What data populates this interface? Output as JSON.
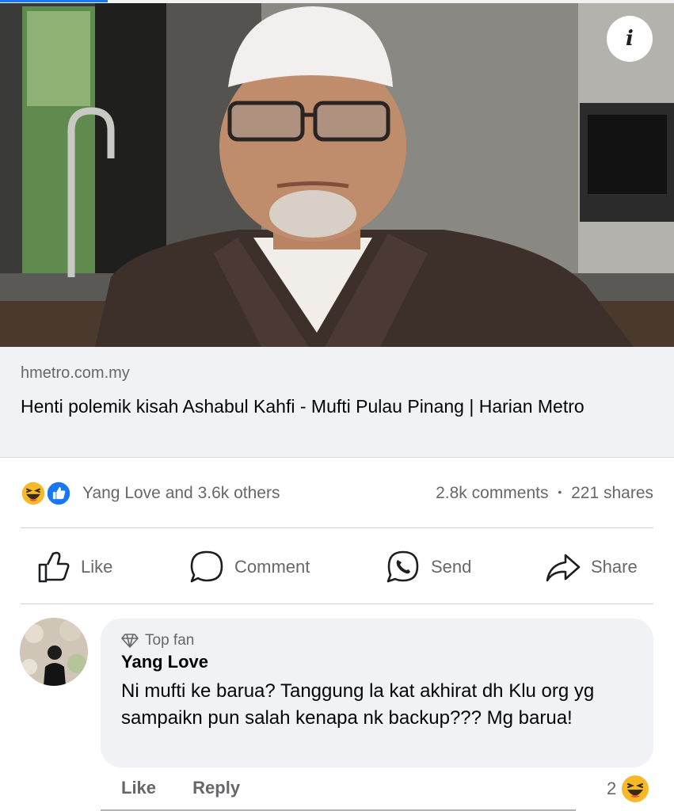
{
  "post": {
    "image": {
      "alt": ""
    },
    "link": {
      "domain": "hmetro.com.my",
      "title": "Henti polemik kisah Ashabul Kahfi - Mufti Pulau Pinang | Harian Metro"
    },
    "reactions": {
      "types": [
        "haha",
        "like"
      ],
      "names_text": "Yang Love and 3.6k others",
      "comments_text": "2.8k comments",
      "separator": "•",
      "shares_text": "221 shares"
    },
    "actions": [
      {
        "label": "Like",
        "icon": "thumbs-up-icon"
      },
      {
        "label": "Comment",
        "icon": "speech-bubble-icon"
      },
      {
        "label": "Send",
        "icon": "whatsapp-icon"
      },
      {
        "label": "Share",
        "icon": "share-arrow-icon"
      }
    ]
  },
  "comment": {
    "badge": "Top fan",
    "author": "Yang Love",
    "text": "Ni mufti ke barua? Tanggung la kat akhirat dh Klu org yg sampaikn pun salah kenapa nk backup??? Mg barua!",
    "like_label": "Like",
    "reply_label": "Reply",
    "reaction_count": "2"
  },
  "colors": {
    "facebook_blue": "#1877f2",
    "secondary_text": "#65676b",
    "bubble_bg": "#f0f2f5",
    "haha_yellow": "#f7b928"
  }
}
